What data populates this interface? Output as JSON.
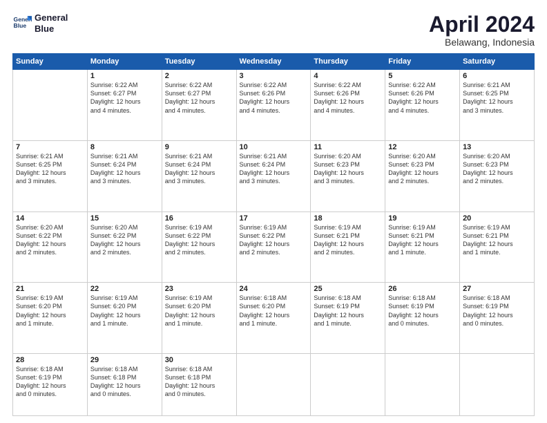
{
  "logo": {
    "line1": "General",
    "line2": "Blue"
  },
  "title": "April 2024",
  "subtitle": "Belawang, Indonesia",
  "header_days": [
    "Sunday",
    "Monday",
    "Tuesday",
    "Wednesday",
    "Thursday",
    "Friday",
    "Saturday"
  ],
  "weeks": [
    [
      {
        "day": "",
        "info": ""
      },
      {
        "day": "1",
        "info": "Sunrise: 6:22 AM\nSunset: 6:27 PM\nDaylight: 12 hours\nand 4 minutes."
      },
      {
        "day": "2",
        "info": "Sunrise: 6:22 AM\nSunset: 6:27 PM\nDaylight: 12 hours\nand 4 minutes."
      },
      {
        "day": "3",
        "info": "Sunrise: 6:22 AM\nSunset: 6:26 PM\nDaylight: 12 hours\nand 4 minutes."
      },
      {
        "day": "4",
        "info": "Sunrise: 6:22 AM\nSunset: 6:26 PM\nDaylight: 12 hours\nand 4 minutes."
      },
      {
        "day": "5",
        "info": "Sunrise: 6:22 AM\nSunset: 6:26 PM\nDaylight: 12 hours\nand 4 minutes."
      },
      {
        "day": "6",
        "info": "Sunrise: 6:21 AM\nSunset: 6:25 PM\nDaylight: 12 hours\nand 3 minutes."
      }
    ],
    [
      {
        "day": "7",
        "info": "Sunrise: 6:21 AM\nSunset: 6:25 PM\nDaylight: 12 hours\nand 3 minutes."
      },
      {
        "day": "8",
        "info": "Sunrise: 6:21 AM\nSunset: 6:24 PM\nDaylight: 12 hours\nand 3 minutes."
      },
      {
        "day": "9",
        "info": "Sunrise: 6:21 AM\nSunset: 6:24 PM\nDaylight: 12 hours\nand 3 minutes."
      },
      {
        "day": "10",
        "info": "Sunrise: 6:21 AM\nSunset: 6:24 PM\nDaylight: 12 hours\nand 3 minutes."
      },
      {
        "day": "11",
        "info": "Sunrise: 6:20 AM\nSunset: 6:23 PM\nDaylight: 12 hours\nand 3 minutes."
      },
      {
        "day": "12",
        "info": "Sunrise: 6:20 AM\nSunset: 6:23 PM\nDaylight: 12 hours\nand 2 minutes."
      },
      {
        "day": "13",
        "info": "Sunrise: 6:20 AM\nSunset: 6:23 PM\nDaylight: 12 hours\nand 2 minutes."
      }
    ],
    [
      {
        "day": "14",
        "info": "Sunrise: 6:20 AM\nSunset: 6:22 PM\nDaylight: 12 hours\nand 2 minutes."
      },
      {
        "day": "15",
        "info": "Sunrise: 6:20 AM\nSunset: 6:22 PM\nDaylight: 12 hours\nand 2 minutes."
      },
      {
        "day": "16",
        "info": "Sunrise: 6:19 AM\nSunset: 6:22 PM\nDaylight: 12 hours\nand 2 minutes."
      },
      {
        "day": "17",
        "info": "Sunrise: 6:19 AM\nSunset: 6:22 PM\nDaylight: 12 hours\nand 2 minutes."
      },
      {
        "day": "18",
        "info": "Sunrise: 6:19 AM\nSunset: 6:21 PM\nDaylight: 12 hours\nand 2 minutes."
      },
      {
        "day": "19",
        "info": "Sunrise: 6:19 AM\nSunset: 6:21 PM\nDaylight: 12 hours\nand 1 minute."
      },
      {
        "day": "20",
        "info": "Sunrise: 6:19 AM\nSunset: 6:21 PM\nDaylight: 12 hours\nand 1 minute."
      }
    ],
    [
      {
        "day": "21",
        "info": "Sunrise: 6:19 AM\nSunset: 6:20 PM\nDaylight: 12 hours\nand 1 minute."
      },
      {
        "day": "22",
        "info": "Sunrise: 6:19 AM\nSunset: 6:20 PM\nDaylight: 12 hours\nand 1 minute."
      },
      {
        "day": "23",
        "info": "Sunrise: 6:19 AM\nSunset: 6:20 PM\nDaylight: 12 hours\nand 1 minute."
      },
      {
        "day": "24",
        "info": "Sunrise: 6:18 AM\nSunset: 6:20 PM\nDaylight: 12 hours\nand 1 minute."
      },
      {
        "day": "25",
        "info": "Sunrise: 6:18 AM\nSunset: 6:19 PM\nDaylight: 12 hours\nand 1 minute."
      },
      {
        "day": "26",
        "info": "Sunrise: 6:18 AM\nSunset: 6:19 PM\nDaylight: 12 hours\nand 0 minutes."
      },
      {
        "day": "27",
        "info": "Sunrise: 6:18 AM\nSunset: 6:19 PM\nDaylight: 12 hours\nand 0 minutes."
      }
    ],
    [
      {
        "day": "28",
        "info": "Sunrise: 6:18 AM\nSunset: 6:19 PM\nDaylight: 12 hours\nand 0 minutes."
      },
      {
        "day": "29",
        "info": "Sunrise: 6:18 AM\nSunset: 6:18 PM\nDaylight: 12 hours\nand 0 minutes."
      },
      {
        "day": "30",
        "info": "Sunrise: 6:18 AM\nSunset: 6:18 PM\nDaylight: 12 hours\nand 0 minutes."
      },
      {
        "day": "",
        "info": ""
      },
      {
        "day": "",
        "info": ""
      },
      {
        "day": "",
        "info": ""
      },
      {
        "day": "",
        "info": ""
      }
    ]
  ]
}
